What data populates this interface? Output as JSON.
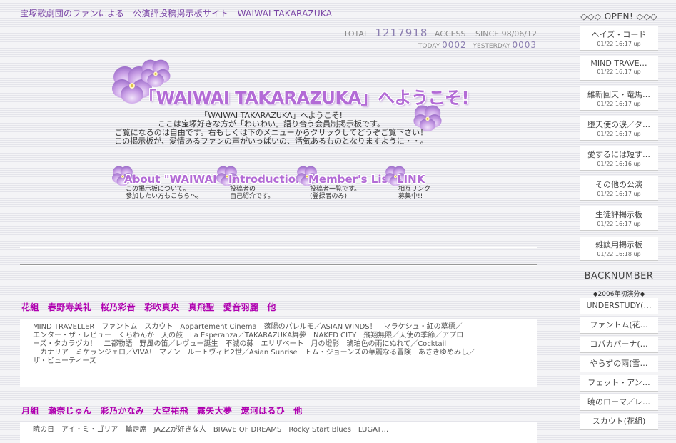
{
  "tagline": "宝塚歌劇団のファンによる　公演評投稿掲示板サイト　WAIWAI TAKARAZUKA",
  "counter": {
    "total_label": "TOTAL",
    "total_value": "1217918",
    "access_label": "ACCESS",
    "since_label": "SINCE 98/06/12",
    "today_label": "TODAY",
    "today_value": "0002",
    "yesterday_label": "YESTERDAY",
    "yesterday_value": "0003"
  },
  "welcome": {
    "title": "「WAIWAI TAKARAZUKA」へようこそ!",
    "lines": [
      "「WAIWAI TAKARAZUKA」へようこそ!",
      "ここは宝塚好きな方が「わいわい」語り合う会員制掲示板です。",
      "ご覧になるのは自由です。右もしくは下のメニューからクリックしてどうぞご覧下さい！",
      "この掲示板が、愛情あるファンの声がいっぱいの、活気あるものとなりますように・・。"
    ]
  },
  "menu": [
    {
      "label": "About \"WAIWAI\"",
      "desc1": "この掲示板について。",
      "desc2": "参加したい方もこちらへ。"
    },
    {
      "label": "Introduction",
      "desc1": "投稿者の",
      "desc2": "自己紹介です。"
    },
    {
      "label": "Member's List",
      "desc1": "投稿者一覧です。",
      "desc2": "(登録者のみ)"
    },
    {
      "label": "LINK",
      "desc1": "相互リンク",
      "desc2": "募集中!!"
    }
  ],
  "sections": [
    {
      "heading": "花組　春野寿美礼　桜乃彩音　彩吹真央　真飛聖　愛音羽麗　他",
      "lines": [
        "MIND TRAVELLER　ファントム　スカウト　Appartement Cinema　落陽のパレルモ／ASIAN WINDS！　マラケシュ・紅の墓標／",
        "エンター・ザ・レビュー　くらわんか　天の鼓　La Esperanza／TAKARAZUKA舞夢　NAKED CITY　飛翔無限／天使の季節／アプロ",
        "ーズ・タカラヅカ！　二都物語　野風の笛／レヴュー誕生　不滅の棘　エリザベート　月の燈影　琥珀色の雨にぬれて／Cocktail",
        "　カナリア　ミケランジェロ／VIVA!　マノン　ルートヴィヒ2世／Asian Sunrise　トム・ジョーンズの華麗なる冒険　あさきゆめみし／",
        "ザ・ビューティーズ"
      ]
    },
    {
      "heading": "月組　瀬奈じゅん　彩乃かなみ　大空祐飛　霧矢大夢　遼河はるひ　他",
      "lines": [
        "暁の日　アイ・ミ・ゴリア　輪走席　JAZZが好きな人　BRAVE OF DREAMS　Rocky Start Blues　LUGAT…"
      ]
    }
  ],
  "sidebar": {
    "open_title": "◇◇◇ OPEN! ◇◇◇",
    "open_items": [
      {
        "title": "ヘイズ・コード",
        "date": "01/22 16:17 up"
      },
      {
        "title": "MIND TRAVE…",
        "date": "01/22 16:17 up"
      },
      {
        "title": "維新回天・竜馬…",
        "date": "01/22 16:17 up"
      },
      {
        "title": "堕天使の涙／タ…",
        "date": "01/22 16:17 up"
      },
      {
        "title": "愛するには短す…",
        "date": "01/22 16:16 up"
      },
      {
        "title": "その他の公演",
        "date": "01/22 16:17 up"
      },
      {
        "title": "生徒評掲示板",
        "date": "01/22 16:17 up"
      },
      {
        "title": "雑談用掲示板",
        "date": "01/22 16:18 up"
      }
    ],
    "back_title": "BACKNUMBER",
    "back_sub": "◆2006年初演分◆",
    "back_items": [
      "UNDERSTUDY(…",
      "ファントム(花…",
      "コパカバーナ(…",
      "やらずの雨(雪…",
      "フェット・アン…",
      "暁のローマ／レ…",
      "スカウト(花組)"
    ]
  },
  "colors": {
    "accent": "#b36bd6",
    "troupe_heading": "#b000b0",
    "tagline": "#7a45a6"
  }
}
